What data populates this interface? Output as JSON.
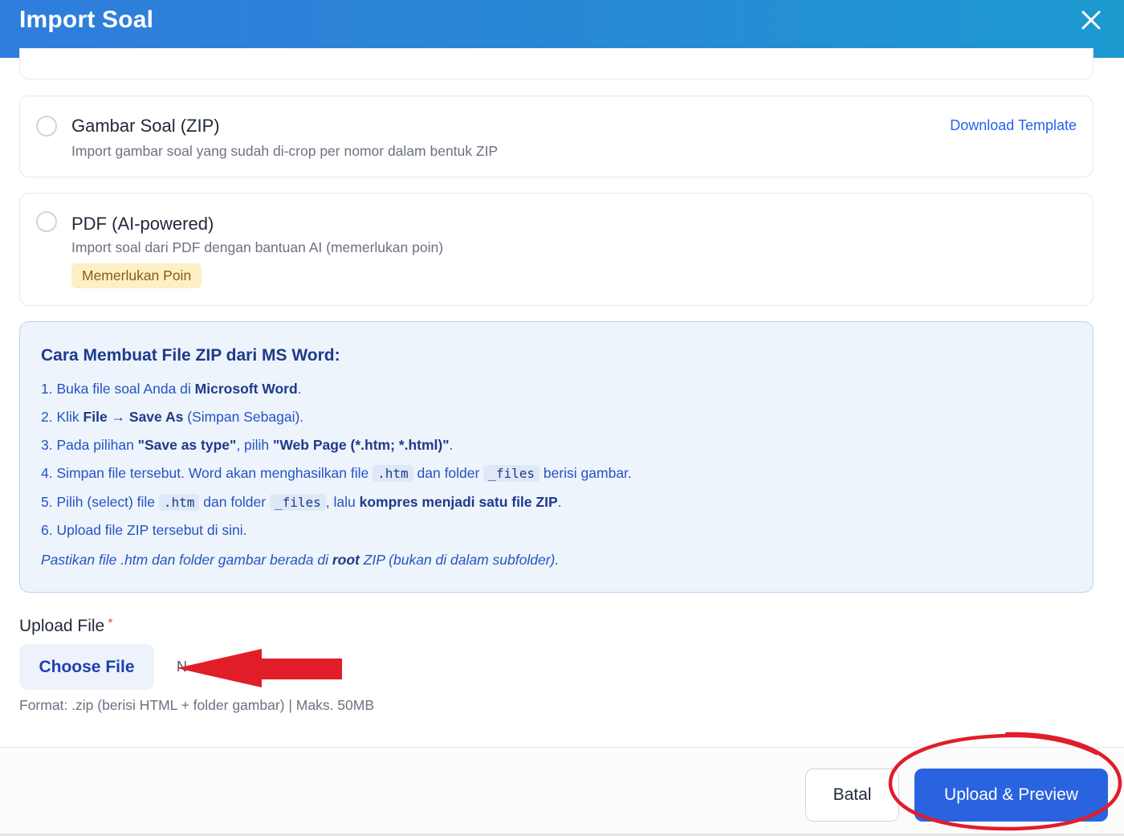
{
  "header": {
    "title": "Import Soal"
  },
  "options": [
    {
      "title": "Gambar Soal (ZIP)",
      "description": "Import gambar soal yang sudah di-crop per nomor dalam bentuk ZIP",
      "link": "Download Template"
    },
    {
      "title": "PDF (AI-powered)",
      "description": "Import soal dari PDF dengan bantuan AI (memerlukan poin)",
      "badge": "Memerlukan Poin"
    }
  ],
  "instructions": {
    "title": "Cara Membuat File ZIP dari MS Word:",
    "step1": {
      "num": "1. ",
      "a": "Buka file soal Anda di ",
      "b": "Microsoft Word",
      "c": "."
    },
    "step2": {
      "num": "2. ",
      "a": "Klik ",
      "b": "File → Save As",
      "c": " (Simpan Sebagai)."
    },
    "step3": {
      "num": "3. ",
      "a": "Pada pilihan ",
      "b": "\"Save as type\"",
      "c": ", pilih ",
      "d": "\"Web Page (*.htm; *.html)\"",
      "e": "."
    },
    "step4": {
      "num": "4. ",
      "a": "Simpan file tersebut. Word akan menghasilkan file ",
      "code1": ".htm",
      "b": " dan folder ",
      "code2": "_files",
      "c": " berisi gambar."
    },
    "step5": {
      "num": "5. ",
      "a": "Pilih (select) file ",
      "code1": ".htm",
      "b": " dan folder ",
      "code2": "_files",
      "c": ", lalu ",
      "d": "kompres menjadi satu file ZIP",
      "e": "."
    },
    "step6": {
      "num": "6. ",
      "a": "Upload file ZIP tersebut di sini."
    },
    "note": {
      "a": "Pastikan file .htm dan folder gambar berada di ",
      "b": "root",
      "c": " ZIP (bukan di dalam subfolder)."
    }
  },
  "upload": {
    "label": "Upload File",
    "required_mark": "*",
    "choose_label": "Choose File",
    "file_status": "N",
    "hint": "Format: .zip (berisi HTML + folder gambar) | Maks. 50MB"
  },
  "footer": {
    "cancel_label": "Batal",
    "submit_label": "Upload & Preview"
  },
  "colors": {
    "primary": "#2a63e0",
    "header_start": "#2f7ddc",
    "header_end": "#1c9ad0",
    "annotation": "#e11d2a"
  }
}
